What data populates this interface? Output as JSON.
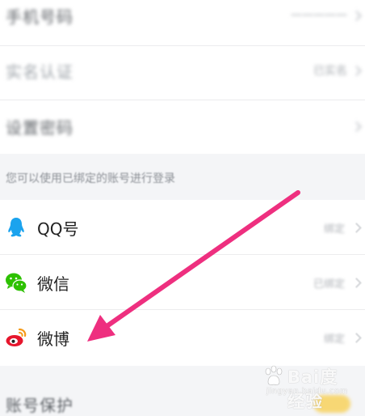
{
  "top_rows": [
    {
      "label": "手机号码",
      "right_text": "一一一一一"
    },
    {
      "label": "实名认证",
      "right_text": "已实名"
    },
    {
      "label": "设置密码",
      "right_text": ""
    }
  ],
  "hint": "您可以使用已绑定的账号进行登录",
  "bind_accounts": [
    {
      "label": "QQ号",
      "status": "绑定",
      "icon": "qq-icon"
    },
    {
      "label": "微信",
      "status": "已绑定",
      "icon": "wechat-icon"
    },
    {
      "label": "微博",
      "status": "绑定",
      "icon": "weibo-icon"
    }
  ],
  "bottom_section": {
    "title": "账号保护"
  },
  "annotation": {
    "color": "#ee2f7f"
  },
  "watermark": {
    "logo": "Bai度经验",
    "url": "jingyan.baidu.com"
  }
}
